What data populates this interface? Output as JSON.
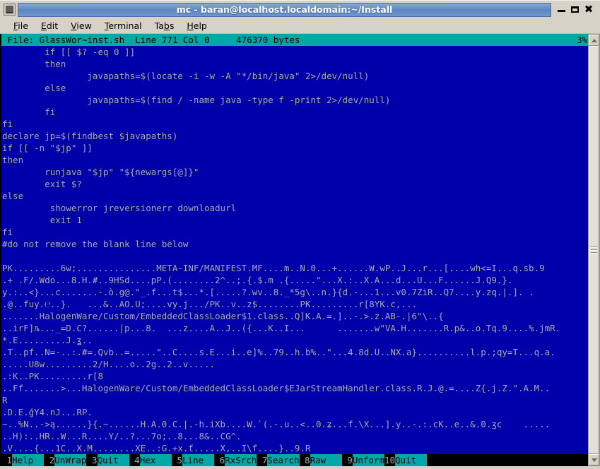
{
  "window": {
    "title": "mc - baran@localhost.localdomain:~/Install",
    "icon": "terminal-icon",
    "buttons": {
      "minimize": "minimize-icon",
      "maximize": "maximize-icon",
      "close": "close-icon"
    }
  },
  "menubar": {
    "items": [
      {
        "label": "File",
        "mnemonic": "F"
      },
      {
        "label": "Edit",
        "mnemonic": "E"
      },
      {
        "label": "View",
        "mnemonic": "V"
      },
      {
        "label": "Terminal",
        "mnemonic": "T"
      },
      {
        "label": "Tabs",
        "mnemonic": "b"
      },
      {
        "label": "Help",
        "mnemonic": "H"
      }
    ]
  },
  "editor": {
    "status_left": " File: GlassWor~inst.sh  Line 771 Col 0     476370 bytes",
    "status_right": "3%",
    "file_name": "GlassWor~inst.sh",
    "line": "771",
    "col": "0",
    "size": "476370 bytes",
    "percent": "3%",
    "lines": [
      "        if [[ $? -eq 0 ]]",
      "        then",
      "                javapaths=$(locate -i -w -A \"*/bin/java\" 2>/dev/null)",
      "        else",
      "                javapaths=$(find / -name java -type f -print 2>/dev/null)",
      "        fi",
      "fi",
      "declare jp=$(findbest $javapaths)",
      "if [[ -n \"$jp\" ]]",
      "then",
      "        runjava \"$jp\" \"${newargs[@]}\"",
      "        exit $?",
      "else",
      "         showerror jreversionerr downloadurl",
      "         exit 1",
      "fi",
      "#do not remove the blank line below",
      "",
      "PK.........6w;...............META-INF/MANIFEST.MF....m..N.0...+......W.wP..J...r...[....wh<=I...q.sb.9",
      ".+ .F/.Wdo...8.H.#..9HSd....pP.(........2^..;.{.$.m .{.....\"...X.:..X.A...d...U...F......J.Q9.}.",
      "y.:..<}...c.......-.ò.g@.\"_.f...t$...*.[.....?.wv..8._*5g\\..n.}{d.-...1...v0.7ZiR..Q7....y.zq.|.]. .",
      ".@..fuy.℮..}.   ...&..AO.U;....vy.j.../PK..v..z$........PK.........r[8YK.c,...",
      ".......HalogenWare/Custom/EmbeddedClassLoader$1.class..Q]K.A.=.]..-.>.z.AB-.|6\"\\..{",
      "..irF]љ..._=D.C?......|p...8.  ...z....A..J..({...K..I...      .......w\"VA.H.......R.p&..o.Tq.9....%.jmR.",
      "*.E.........J.ʓ..",
      ".T..pf..N=-..:.#=.Qvb..=.....\"..C....s.E...i..e]%..79..h.b%..\"...4.8d.U..NX.a}..........l.p.;qy=T...q.a.",
      ".....U8w.........2/H....o..2g..2..v.....",
      ".:K..PK.........r[8",
      "..Ff.......>...HalogenWare/Custom/EmbeddedClassLoader$EJarStreamHandler.class.R.J.@.=....Z{.j.Z.\".A.M..",
      "R",
      ".D.E.ǵY4.nJ...RP.",
      "~..%N..->ą......}{.~......H.A.0.C.|.-h.iXb....W.`(.-.u..<..0.ʑ...f.\\X...].y..-.:.cK..e..&.0.ʒc    .....",
      "..H):..HR..W...R....Y/..?...7o;..8...8&..CG^.",
      ".V....{...1C..X.M........XE..:G.+x.ť.....X,..I\\f....}..9.R"
    ]
  },
  "fkeys": [
    {
      "num": "1",
      "label": "Help"
    },
    {
      "num": "2",
      "label": "UnWrap"
    },
    {
      "num": "3",
      "label": "Quit"
    },
    {
      "num": "4",
      "label": "Hex"
    },
    {
      "num": "5",
      "label": "Line"
    },
    {
      "num": "6",
      "label": "RxSrch"
    },
    {
      "num": "7",
      "label": "Search"
    },
    {
      "num": "8",
      "label": "Raw"
    },
    {
      "num": "9",
      "label": "Unform"
    },
    {
      "num": "10",
      "label": "Quit"
    }
  ],
  "scrollbar": {
    "up": "scroll-up-arrow",
    "down": "scroll-down-arrow"
  },
  "colors": {
    "terminal_bg": "#0000aa",
    "terminal_fg": "#aaaaaa",
    "status_bg": "#00a8a8",
    "status_fg": "#000000",
    "chrome_bg": "#d6d2c8",
    "title_accent": "#5c87c4"
  }
}
